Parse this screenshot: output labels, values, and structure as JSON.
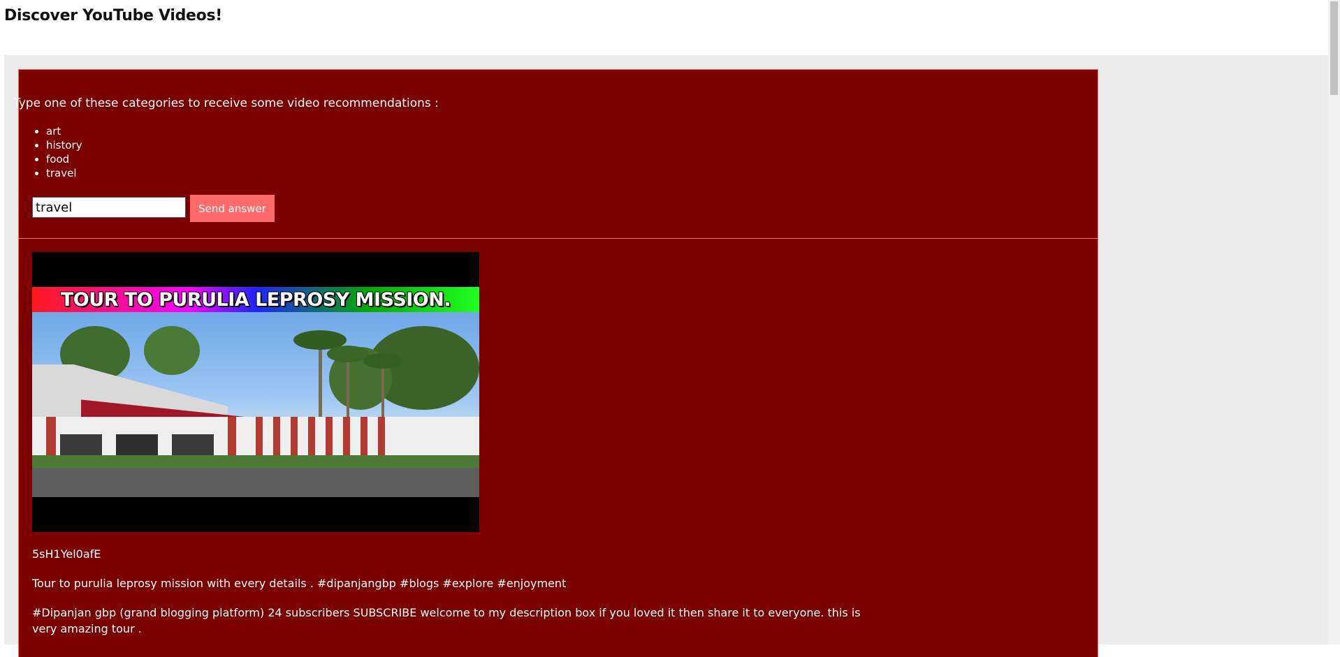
{
  "page": {
    "title": "Discover YouTube Videos!"
  },
  "form": {
    "prompt": "Type one of these categories to receive some video recommendations :",
    "categories": [
      "art",
      "history",
      "food",
      "travel"
    ],
    "input_value": "travel",
    "submit_label": "Send answer"
  },
  "video": {
    "thumbnail_text": "TOUR TO PURULIA LEPROSY MISSION.",
    "id": "5sH1Yel0afE",
    "title": "Tour to purulia leprosy mission with every details . #dipanjangbp #blogs #explore #enjoyment",
    "description": "#Dipanjan gbp (grand blogging platform) 24 subscribers SUBSCRIBE welcome to my description box if you loved it then share it to everyone. this is very amazing tour ."
  },
  "colors": {
    "panel_bg": "#7a0000",
    "panel_border": "#ff6b6b",
    "button_bg": "#ff6b6b",
    "page_bg": "#ebebeb"
  }
}
